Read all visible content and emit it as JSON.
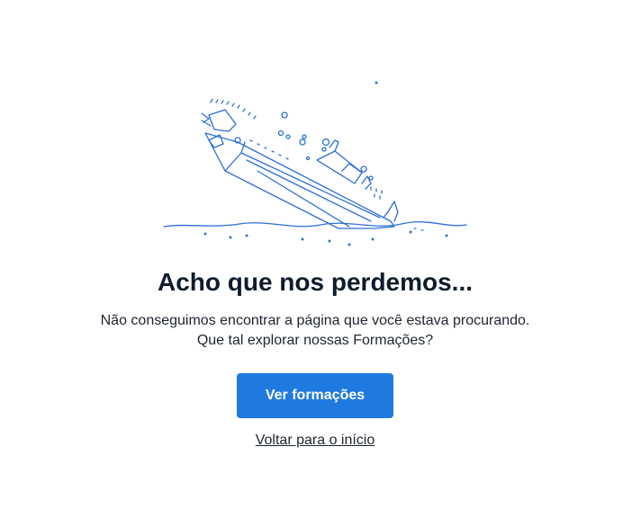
{
  "illustration": {
    "icon": "sinking-ship-icon",
    "stroke_color": "#2b6fd6"
  },
  "heading": {
    "title": "Acho que nos perdemos..."
  },
  "message": {
    "line1": "Não conseguimos encontrar a página que você estava procurando.",
    "line2": "Que tal explorar nossas Formações?"
  },
  "actions": {
    "primary_label": "Ver formações",
    "secondary_label": "Voltar para o início"
  },
  "colors": {
    "primary": "#1f7ae0",
    "heading": "#0f1b2d",
    "text": "#1e2430"
  }
}
